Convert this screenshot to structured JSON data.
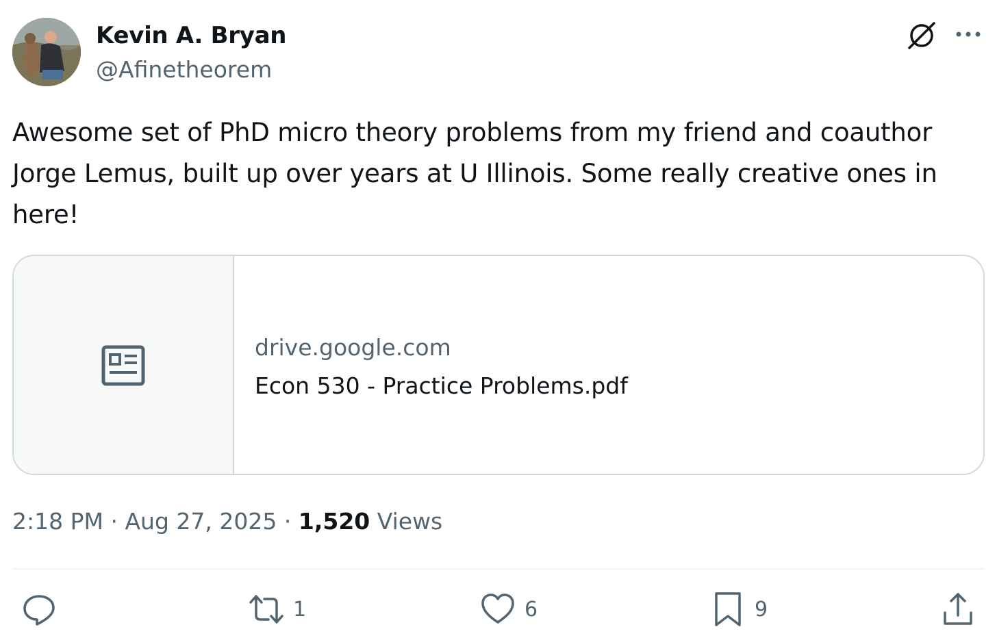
{
  "author": {
    "name": "Kevin A. Bryan",
    "handle": "@Afinetheorem"
  },
  "tweet": {
    "text": "Awesome set of PhD micro theory problems from my friend and coauthor Jorge Lemus, built up over years at U Illinois. Some really creative ones in here!"
  },
  "card": {
    "domain": "drive.google.com",
    "title": "Econ 530 - Practice Problems.pdf",
    "thumb_icon": "article-icon"
  },
  "meta": {
    "time": "2:18 PM",
    "separator": "·",
    "date": "Aug 27, 2025",
    "views_count": "1,520",
    "views_label": "Views"
  },
  "actions": {
    "reply": {
      "icon": "reply-icon",
      "count": ""
    },
    "retweet": {
      "icon": "retweet-icon",
      "count": "1"
    },
    "like": {
      "icon": "heart-icon",
      "count": "6"
    },
    "bookmark": {
      "icon": "bookmark-icon",
      "count": "9"
    },
    "share": {
      "icon": "share-icon"
    }
  },
  "colors": {
    "text": "#0f1419",
    "secondary": "#536471",
    "border": "#cfd9de",
    "thumb_bg": "#f7f9f9"
  }
}
